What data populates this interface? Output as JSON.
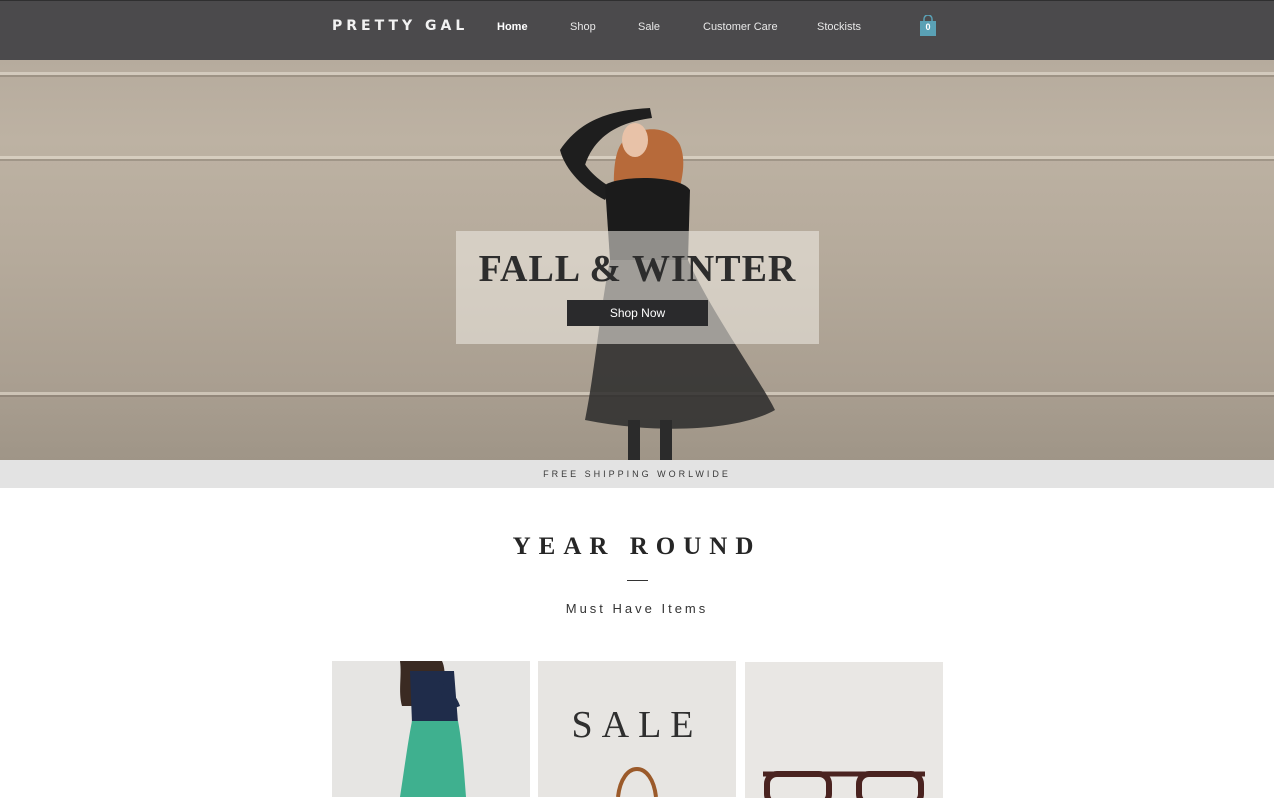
{
  "brand": {
    "logo": "PRETTY GAL"
  },
  "nav": {
    "items": [
      {
        "label": "Home",
        "active": true
      },
      {
        "label": "Shop",
        "active": false
      },
      {
        "label": "Sale",
        "active": false
      },
      {
        "label": "Customer Care",
        "active": false
      },
      {
        "label": "Stockists",
        "active": false
      }
    ]
  },
  "cart": {
    "count": "0",
    "icon": "shopping-bag-icon",
    "color": "#5aa1b5"
  },
  "hero": {
    "title": "FALL & WINTER",
    "button_label": "Shop Now"
  },
  "shipping": {
    "text": "FREE SHIPPING WORLWIDE"
  },
  "section": {
    "title": "YEAR ROUND",
    "subtitle": "Must Have Items"
  },
  "cards": [
    {
      "name": "green-skirt-product",
      "label": ""
    },
    {
      "name": "sale-bag-product",
      "label": "SALE"
    },
    {
      "name": "glasses-product",
      "label": ""
    }
  ],
  "colors": {
    "header": "#4b4a4c",
    "strip": "#e3e3e3",
    "button": "#2a2a2c"
  }
}
